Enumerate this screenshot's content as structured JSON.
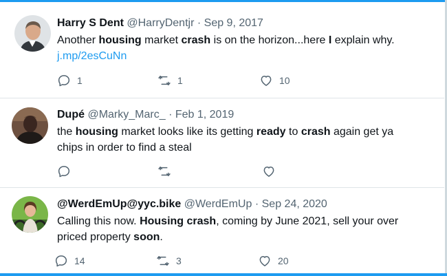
{
  "tweets": [
    {
      "name": "Harry S Dent",
      "handle": "@HarryDentjr",
      "separator": "·",
      "date": "Sep 9, 2017",
      "text": [
        {
          "t": "Another ",
          "b": false
        },
        {
          "t": "housing",
          "b": true
        },
        {
          "t": " market ",
          "b": false
        },
        {
          "t": "crash",
          "b": true
        },
        {
          "t": " is on the horizon...here ",
          "b": false
        },
        {
          "t": "I",
          "b": true
        },
        {
          "t": " explain why.",
          "b": false
        }
      ],
      "link": "j.mp/2esCuNn",
      "replies": "1",
      "retweets": "1",
      "likes": "10"
    },
    {
      "name": "Dupé",
      "handle": "@Marky_Marc_",
      "separator": "·",
      "date": "Feb 1, 2019",
      "text": [
        {
          "t": "the ",
          "b": false
        },
        {
          "t": "housing",
          "b": true
        },
        {
          "t": " market looks like its getting ",
          "b": false
        },
        {
          "t": "ready",
          "b": true
        },
        {
          "t": " to ",
          "b": false
        },
        {
          "t": "crash",
          "b": true
        },
        {
          "t": " again get ya chips in order to find a steal",
          "b": false
        }
      ],
      "link": "",
      "replies": "",
      "retweets": "",
      "likes": ""
    },
    {
      "name": "@WerdEmUp@yyc.bike",
      "handle": "@WerdEmUp",
      "separator": "·",
      "date": "Sep 24, 2020",
      "text": [
        {
          "t": "Calling this now. ",
          "b": false
        },
        {
          "t": "Housing crash",
          "b": true
        },
        {
          "t": ", coming by June 2021, sell your over priced property ",
          "b": false
        },
        {
          "t": "soon",
          "b": true
        },
        {
          "t": ".",
          "b": false
        }
      ],
      "link": "",
      "replies": "14",
      "retweets": "3",
      "likes": "20"
    }
  ],
  "icons": {
    "reply": "reply-icon",
    "retweet": "retweet-icon",
    "like": "heart-icon"
  },
  "colors": {
    "accent": "#1d9bf0",
    "text": "#0f1419",
    "muted": "#536471"
  }
}
